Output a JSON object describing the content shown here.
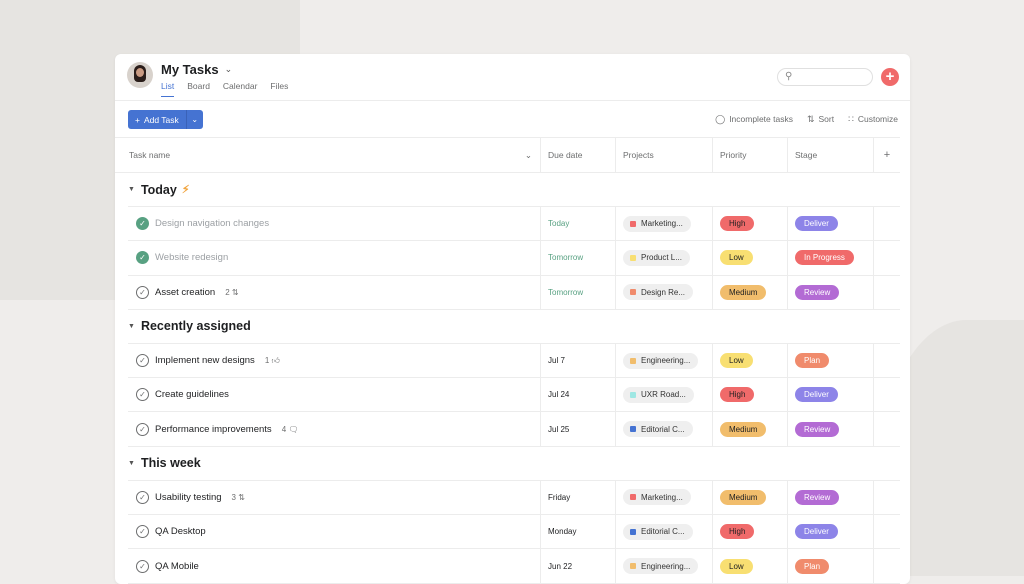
{
  "header": {
    "title": "My Tasks",
    "tabs": [
      "List",
      "Board",
      "Calendar",
      "Files"
    ],
    "active_tab": "List"
  },
  "toolbar": {
    "add_task": "Add Task",
    "incomplete": "Incomplete tasks",
    "sort": "Sort",
    "customize": "Customize"
  },
  "columns": {
    "task": "Task name",
    "due": "Due date",
    "projects": "Projects",
    "priority": "Priority",
    "stage": "Stage",
    "add": "+"
  },
  "colors": {
    "accent": "#4573d2",
    "add_button": "#f06a6a",
    "complete": "#58a182",
    "priority": {
      "High": "#f06a6a",
      "Low": "#f8df72",
      "Medium": "#f1bd6c"
    },
    "stage": {
      "Deliver": "#8d84e8",
      "In Progress": "#f06a6a",
      "Review": "#b36bd4",
      "Plan": "#f08b6c"
    }
  },
  "sections": [
    {
      "title": "Today",
      "icon": "lightning-icon",
      "tasks": [
        {
          "name": "Design navigation changes",
          "done": true,
          "due": "Today",
          "due_green": true,
          "project": "Marketing...",
          "project_color": "#f06a6a",
          "priority": "High",
          "stage": "Deliver"
        },
        {
          "name": "Website redesign",
          "done": true,
          "due": "Tomorrow",
          "due_green": true,
          "project": "Product L...",
          "project_color": "#f8df72",
          "priority": "Low",
          "stage": "In Progress"
        },
        {
          "name": "Asset creation",
          "done": false,
          "meta": "2",
          "meta_icon": "subtask-icon",
          "due": "Tomorrow",
          "due_green": true,
          "project": "Design Re...",
          "project_color": "#f08b6c",
          "priority": "Medium",
          "stage": "Review"
        }
      ]
    },
    {
      "title": "Recently assigned",
      "tasks": [
        {
          "name": "Implement new designs",
          "done": false,
          "meta": "1",
          "meta_icon": "thumbs-up-icon",
          "due": "Jul 7",
          "project": "Engineering...",
          "project_color": "#f1bd6c",
          "priority": "Low",
          "stage": "Plan"
        },
        {
          "name": "Create guidelines",
          "done": false,
          "due": "Jul 24",
          "project": "UXR Road...",
          "project_color": "#9ee7e3",
          "priority": "High",
          "stage": "Deliver"
        },
        {
          "name": "Performance improvements",
          "done": false,
          "meta": "4",
          "meta_icon": "comment-icon",
          "due": "Jul 25",
          "project": "Editorial C...",
          "project_color": "#4573d2",
          "priority": "Medium",
          "stage": "Review"
        }
      ]
    },
    {
      "title": "This week",
      "tasks": [
        {
          "name": "Usability testing",
          "done": false,
          "meta": "3",
          "meta_icon": "subtask-icon",
          "due": "Friday",
          "project": "Marketing...",
          "project_color": "#f06a6a",
          "priority": "Medium",
          "stage": "Review"
        },
        {
          "name": "QA Desktop",
          "done": false,
          "due": "Monday",
          "project": "Editorial C...",
          "project_color": "#4573d2",
          "priority": "High",
          "stage": "Deliver"
        },
        {
          "name": "QA Mobile",
          "done": false,
          "due": "Jun 22",
          "project": "Engineering...",
          "project_color": "#f1bd6c",
          "priority": "Low",
          "stage": "Plan"
        }
      ]
    }
  ]
}
